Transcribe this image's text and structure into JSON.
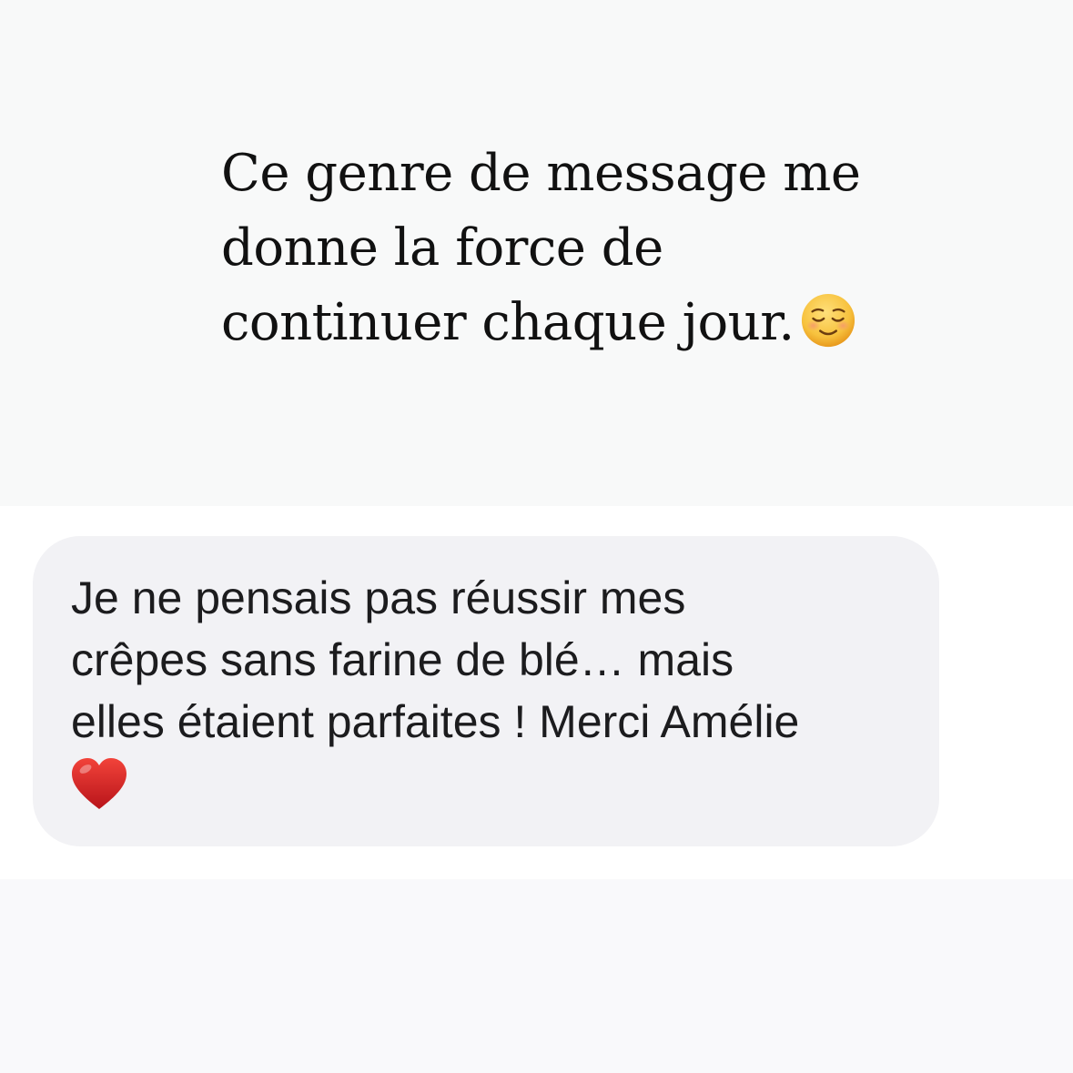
{
  "caption": {
    "lines": [
      "Ce genre de message me",
      "donne la force de",
      "continuer chaque jour."
    ],
    "emoji_icon": "smiling-face-icon"
  },
  "message": {
    "lines": [
      "Je ne pensais pas réussir mes",
      "crêpes sans farine de blé… mais",
      "elles étaient parfaites ! Merci Amélie"
    ],
    "emoji_icon": "red-heart-icon"
  },
  "colors": {
    "background_top": "#f8f9f9",
    "background_mid": "#ffffff",
    "bubble": "#f2f2f5",
    "text": "#111111"
  }
}
